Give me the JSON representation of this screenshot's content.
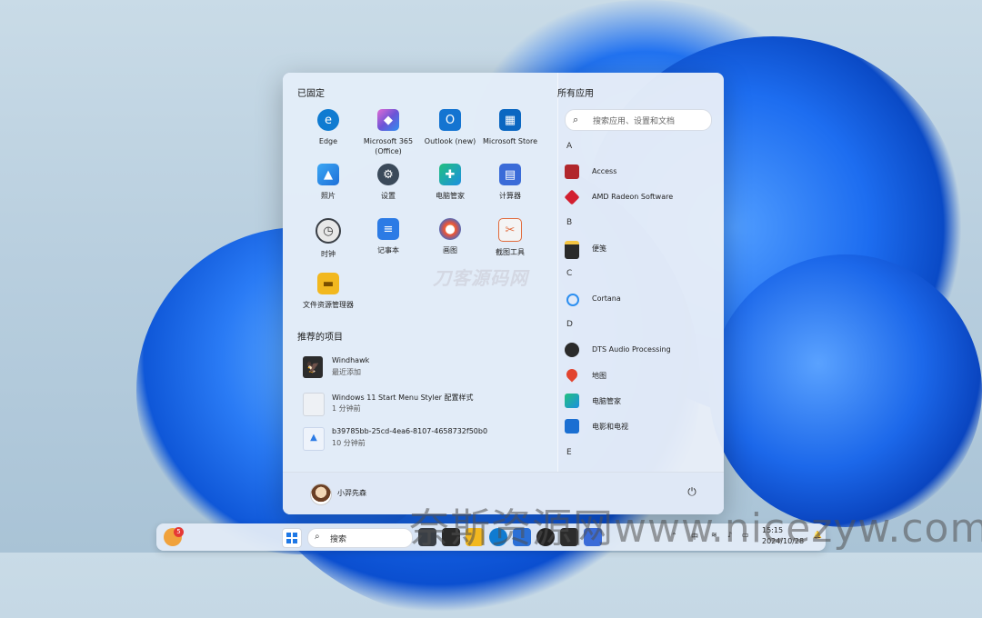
{
  "start_menu": {
    "pinned_title": "已固定",
    "pinned": [
      {
        "label": "Edge",
        "icon": "edge-icon",
        "color": "#0f7bd1"
      },
      {
        "label": "Microsoft 365\n(Office)",
        "icon": "office-icon",
        "color": "#6c54d6"
      },
      {
        "label": "Outlook (new)",
        "icon": "outlook-icon",
        "color": "#1474d1"
      },
      {
        "label": "Microsoft Store",
        "icon": "store-icon",
        "color": "#0b67c1"
      },
      {
        "label": "照片",
        "icon": "photos-icon",
        "color": "#2c8fe0"
      },
      {
        "label": "设置",
        "icon": "settings-icon",
        "color": "#3b4a5a"
      },
      {
        "label": "电脑管家",
        "icon": "pc-manager-icon",
        "color": "#1aa36f"
      },
      {
        "label": "计算器",
        "icon": "calculator-icon",
        "color": "#3a6bd8"
      },
      {
        "label": "时钟",
        "icon": "clock-icon",
        "color": "#3a3f46"
      },
      {
        "label": "记事本",
        "icon": "notepad-icon",
        "color": "#2c7be5"
      },
      {
        "label": "画图",
        "icon": "paint-icon",
        "color": "#2b6fd6"
      },
      {
        "label": "截图工具",
        "icon": "snipping-tool-icon",
        "color": "#e06a3c"
      },
      {
        "label": "文件资源管理器",
        "icon": "file-explorer-icon",
        "color": "#f2b81f"
      }
    ],
    "watermark": "刀客源码网",
    "recommended_title": "推荐的项目",
    "recommended": [
      {
        "title": "Windhawk",
        "subtitle": "最近添加",
        "icon": "windhawk-icon",
        "color": "#2c2c2c"
      },
      {
        "title": "Windows 11 Start Menu Styler 配置样式",
        "subtitle": "1 分钟前",
        "icon": "document-icon",
        "color": "#e9edf2"
      },
      {
        "title": "b39785bb-25cd-4ea6-8107-4658732f50b0",
        "subtitle": "10 分钟前",
        "icon": "image-file-icon",
        "color": "#dfe8f5"
      }
    ],
    "all_apps_title": "所有应用",
    "search_placeholder": "搜索应用、设置和文档",
    "groups": [
      {
        "letter": "A",
        "apps": [
          {
            "name": "Access",
            "icon": "access-icon",
            "color": "#b1272c"
          },
          {
            "name": "AMD Radeon Software",
            "icon": "amd-icon",
            "color": "#d21f30"
          }
        ]
      },
      {
        "letter": "B",
        "apps": [
          {
            "name": "便笺",
            "icon": "sticky-notes-icon",
            "color": "#2a2a2a"
          }
        ]
      },
      {
        "letter": "C",
        "apps": [
          {
            "name": "Cortana",
            "icon": "cortana-icon",
            "color": "#2d8ff0"
          }
        ]
      },
      {
        "letter": "D",
        "apps": [
          {
            "name": "DTS Audio Processing",
            "icon": "dts-icon",
            "color": "#2b2b2b"
          },
          {
            "name": "地图",
            "icon": "maps-icon",
            "color": "#e2442f"
          },
          {
            "name": "电脑管家",
            "icon": "pc-manager-icon",
            "color": "#1aa36f"
          },
          {
            "name": "电影和电视",
            "icon": "movies-tv-icon",
            "color": "#1b6fd2"
          }
        ]
      },
      {
        "letter": "E",
        "apps": []
      }
    ],
    "username": "小羿先森"
  },
  "taskbar": {
    "search_label": "搜索",
    "badge_count": "5",
    "tray_lang": "中",
    "time": "15:15",
    "date": "2024/10/28"
  },
  "overlay_watermark": "奈斯资源网www.nicezyw.com"
}
